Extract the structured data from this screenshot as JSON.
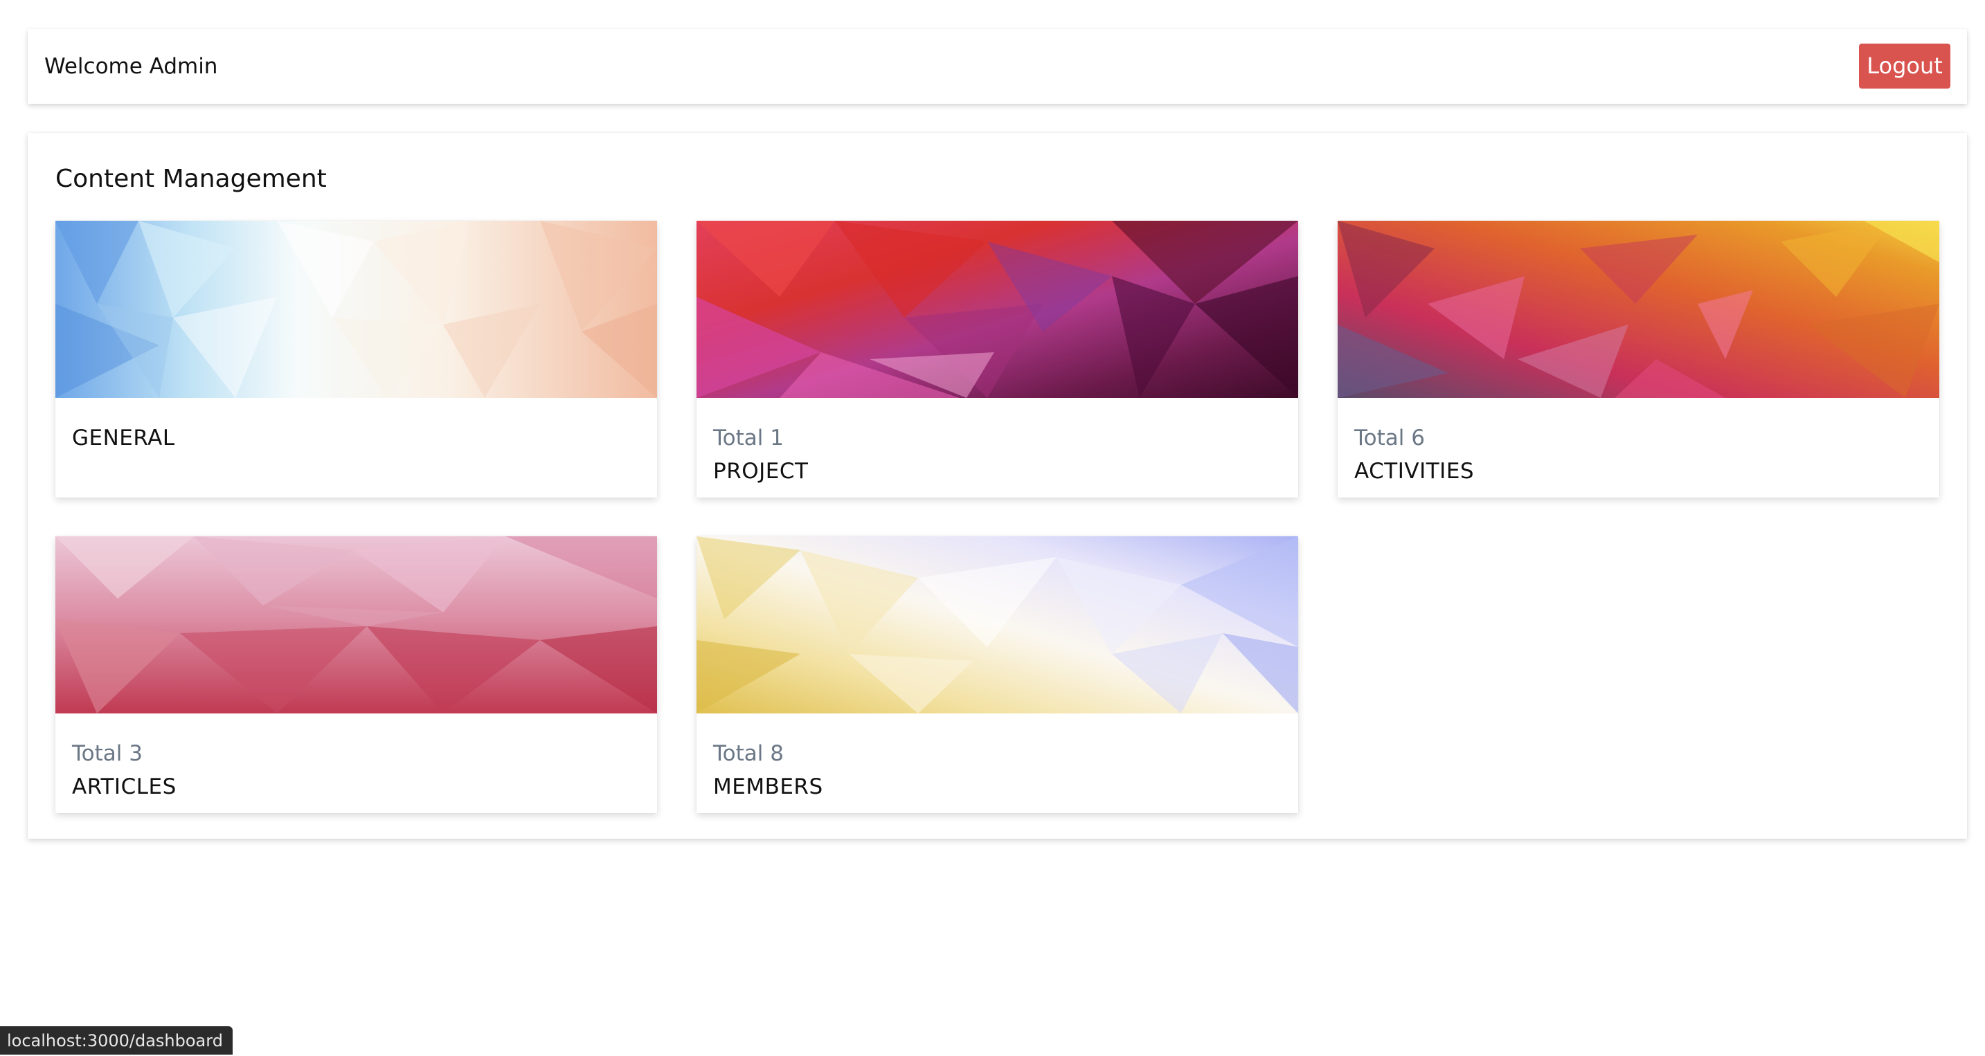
{
  "header": {
    "welcome_text": "Welcome Admin",
    "logout_label": "Logout",
    "logout_color": "#d9534f"
  },
  "content": {
    "title": "Content Management",
    "cards": [
      {
        "total": "",
        "title": "GENERAL",
        "theme": "light blue-white-peach polygon"
      },
      {
        "total": "Total 1",
        "title": "PROJECT",
        "theme": "red-magenta polygon"
      },
      {
        "total": "Total 6",
        "title": "ACTIVITIES",
        "theme": "purple-orange-gold polygon"
      },
      {
        "total": "Total 3",
        "title": "ARTICLES",
        "theme": "pink-crimson polygon"
      },
      {
        "total": "Total 8",
        "title": "MEMBERS",
        "theme": "gold-white-lavender polygon"
      }
    ]
  },
  "status_bar": {
    "url": "localhost:3000/dashboard"
  }
}
